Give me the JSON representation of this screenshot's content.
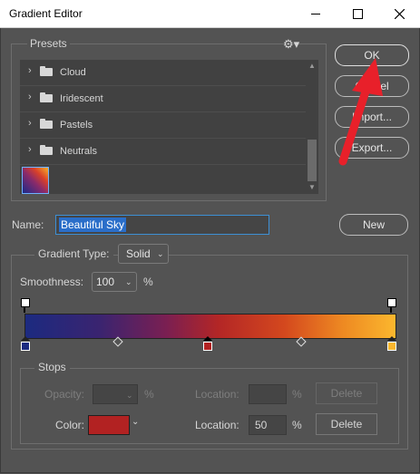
{
  "window": {
    "title": "Gradient Editor"
  },
  "presets": {
    "label": "Presets",
    "folders": [
      {
        "label": "Cloud"
      },
      {
        "label": "Iridescent"
      },
      {
        "label": "Pastels"
      },
      {
        "label": "Neutrals"
      }
    ]
  },
  "buttons": {
    "ok": "OK",
    "cancel": "Cancel",
    "import": "Import...",
    "export": "Export...",
    "new": "New"
  },
  "name": {
    "label": "Name:",
    "value": "Beautiful Sky"
  },
  "gradient": {
    "type_label": "Gradient Type:",
    "type_value": "Solid",
    "smoothness_label": "Smoothness:",
    "smoothness_value": "100",
    "smoothness_unit": "%",
    "colors": [
      "#1c2a80",
      "#3a2470",
      "#7a1f52",
      "#b32626",
      "#d4481e",
      "#ee8a22",
      "#fbb72e"
    ]
  },
  "stops": {
    "label": "Stops",
    "opacity_label": "Opacity:",
    "opacity_value": "",
    "opacity_unit": "%",
    "opacity_location_label": "Location:",
    "opacity_location_value": "",
    "opacity_location_unit": "%",
    "opacity_delete": "Delete",
    "color_label": "Color:",
    "color_value": "#b22222",
    "color_location_label": "Location:",
    "color_location_value": "50",
    "color_location_unit": "%",
    "color_delete": "Delete"
  },
  "icons": [
    "close-icon",
    "maximize-icon",
    "minimize-icon",
    "gear-icon",
    "folder-icon",
    "chevron-right-icon",
    "chevron-down-icon",
    "red-arrow-annotation"
  ]
}
